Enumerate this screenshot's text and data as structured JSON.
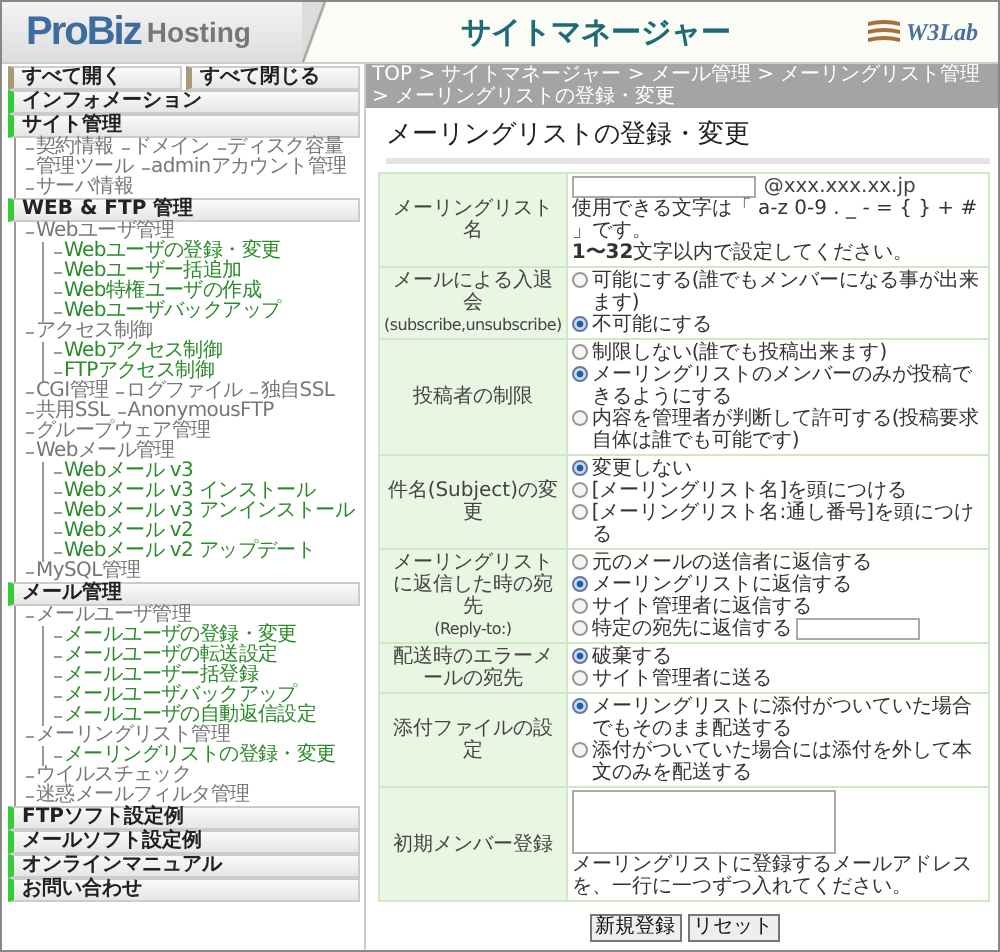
{
  "header": {
    "logo_primary": "ProBiz",
    "logo_secondary": "Hosting",
    "title": "サイトマネージャー",
    "brand": "W3Lab"
  },
  "breadcrumb": "TOP > サイトマネージャー > メール管理 > メーリングリスト管理 > メーリングリストの登録・変更",
  "sidebar": {
    "toggle_buttons": [
      "すべて開く",
      "すべて閉じる"
    ],
    "sections": [
      {
        "label": "インフォメーション"
      },
      {
        "label": "サイト管理",
        "children": [
          {
            "label": "契約情報"
          },
          {
            "label": "ドメイン"
          },
          {
            "label": "ディスク容量"
          },
          {
            "label": "管理ツール"
          },
          {
            "label": "adminアカウント管理"
          },
          {
            "label": "サーバ情報"
          }
        ]
      },
      {
        "label": "WEB & FTP 管理",
        "children": [
          {
            "label": "Webユーザ管理",
            "children": [
              {
                "label": "Webユーザの登録・変更"
              },
              {
                "label": "Webユーザー括追加"
              },
              {
                "label": "Web特権ユーザの作成"
              },
              {
                "label": "Webユーザバックアップ"
              }
            ]
          },
          {
            "label": "アクセス制御",
            "children": [
              {
                "label": "Webアクセス制御"
              },
              {
                "label": "FTPアクセス制御"
              }
            ]
          },
          {
            "label": "CGI管理"
          },
          {
            "label": "ログファイル"
          },
          {
            "label": "独自SSL"
          },
          {
            "label": "共用SSL"
          },
          {
            "label": "AnonymousFTP"
          },
          {
            "label": "グループウェア管理"
          },
          {
            "label": "Webメール管理",
            "children": [
              {
                "label": "Webメール v3"
              },
              {
                "label": "Webメール v3 インストール"
              },
              {
                "label": "Webメール v3 アンインストール"
              },
              {
                "label": "Webメール v2"
              },
              {
                "label": "Webメール v2 アップデート"
              }
            ]
          },
          {
            "label": "MySQL管理"
          }
        ]
      },
      {
        "label": "メール管理",
        "children": [
          {
            "label": "メールユーザ管理",
            "children": [
              {
                "label": "メールユーザの登録・変更"
              },
              {
                "label": "メールユーザの転送設定"
              },
              {
                "label": "メールユーザー括登録"
              },
              {
                "label": "メールユーザバックアップ"
              },
              {
                "label": "メールユーザの自動返信設定"
              }
            ]
          },
          {
            "label": "メーリングリスト管理",
            "children": [
              {
                "label": "メーリングリストの登録・変更"
              }
            ]
          },
          {
            "label": "ウイルスチェック"
          },
          {
            "label": "迷惑メールフィルタ管理"
          }
        ]
      },
      {
        "label": "FTPソフト設定例"
      },
      {
        "label": "メールソフト設定例"
      },
      {
        "label": "オンラインマニュアル"
      },
      {
        "label": "お問い合わせ"
      }
    ]
  },
  "page_title": "メーリングリストの登録・変更",
  "form": {
    "rows": [
      {
        "kind": "name",
        "label": "メーリングリスト名",
        "domain": "@xxx.xxx.xx.jp",
        "notes": [
          "使用できる文字は「 a-z 0-9 . _ - = { } + # 」です。",
          "**1〜32**文字以内で設定してください。"
        ]
      },
      {
        "kind": "choice",
        "label": "メールによる入退会",
        "sublabel": "(subscribe,unsubscribe)",
        "options": [
          {
            "label": "可能にする(誰でもメンバーになる事が出来ます)",
            "selected": false
          },
          {
            "label": "不可能にする",
            "selected": true
          }
        ]
      },
      {
        "kind": "choice",
        "label": "投稿者の制限",
        "options": [
          {
            "label": "制限しない(誰でも投稿出来ます)",
            "selected": false
          },
          {
            "label": "メーリングリストのメンバーのみが投稿できるようにする",
            "selected": true
          },
          {
            "label": "内容を管理者が判断して許可する(投稿要求自体は誰でも可能です)",
            "selected": false
          }
        ]
      },
      {
        "kind": "choice",
        "label": "件名(Subject)の変更",
        "options": [
          {
            "label": "変更しない",
            "selected": true
          },
          {
            "label": "[メーリングリスト名]を頭につける",
            "selected": false
          },
          {
            "label": "[メーリングリスト名:通し番号]を頭につける",
            "selected": false
          }
        ]
      },
      {
        "kind": "choice",
        "label": "メーリングリストに返信した時の宛先",
        "sublabel": "(Reply-to:)",
        "options": [
          {
            "label": "元のメールの送信者に返信する",
            "selected": false
          },
          {
            "label": "メーリングリストに返信する",
            "selected": true
          },
          {
            "label": "サイト管理者に返信する",
            "selected": false
          },
          {
            "label": "特定の宛先に返信する",
            "selected": false,
            "kind": "with_field"
          }
        ]
      },
      {
        "kind": "choice",
        "label": "配送時のエラーメールの宛先",
        "options": [
          {
            "label": "破棄する",
            "selected": true
          },
          {
            "label": "サイト管理者に送る",
            "selected": false
          }
        ]
      },
      {
        "kind": "choice",
        "label": "添付ファイルの設定",
        "options": [
          {
            "label": "メーリングリストに添付がついていた場合でもそのまま配送する",
            "selected": true
          },
          {
            "label": "添付がついていた場合には添付を外して本文のみを配送する",
            "selected": false
          }
        ]
      },
      {
        "kind": "members",
        "label": "初期メンバー登録",
        "note": "メーリングリストに登録するメールアドレスを、一行に一つずつ入れてください。"
      }
    ]
  },
  "buttons": [
    "新規登録",
    "リセット"
  ]
}
